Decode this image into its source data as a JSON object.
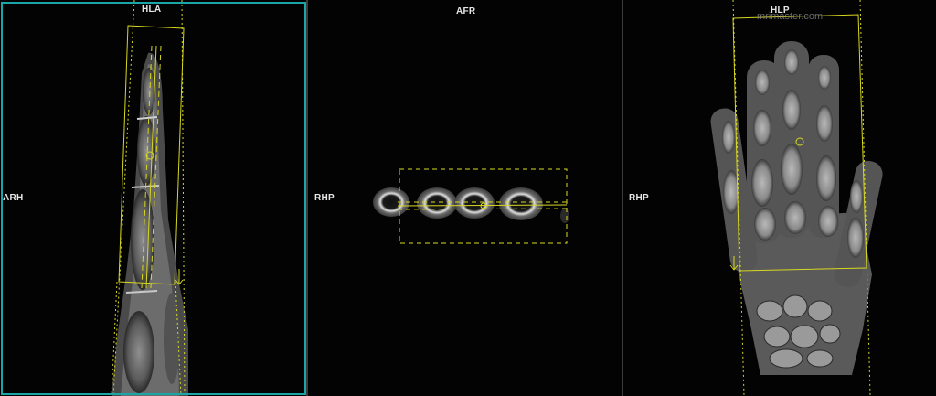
{
  "viewports": [
    {
      "orientation": {
        "top": "HLA",
        "left": "ARH"
      },
      "active_color": "#1aa6a6"
    },
    {
      "orientation": {
        "top": "AFR",
        "left": "RHP"
      }
    },
    {
      "orientation": {
        "top": "HLP",
        "left": "RHP"
      },
      "watermark": "mrimaster.com"
    }
  ],
  "colors": {
    "overlay": "#d8d820",
    "label": "#e6e6e6",
    "divider": "#3c3c3c",
    "background": "#000000"
  },
  "icons": [
    "center-circle-icon",
    "rotate-handle-icon",
    "slice-arrow-icon"
  ]
}
